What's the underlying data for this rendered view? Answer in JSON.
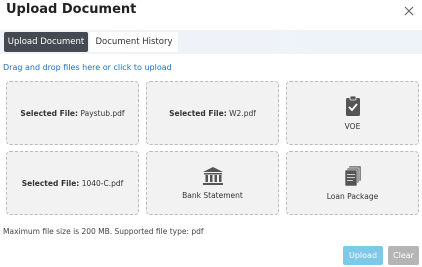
{
  "dialog": {
    "title": "Upload Document"
  },
  "tabs": [
    {
      "label": "Upload Document",
      "active": true
    },
    {
      "label": "Document History",
      "active": false
    }
  ],
  "dropzone": {
    "hint": "Drag and drop files here or click to upload"
  },
  "cards": [
    {
      "selected_label": "Selected File:",
      "file": "Paystub.pdf"
    },
    {
      "selected_label": "Selected File:",
      "file": "W2.pdf"
    },
    {
      "label": "VOE",
      "icon": "clipboard-check-icon"
    },
    {
      "selected_label": "Selected File:",
      "file": "1040-C.pdf"
    },
    {
      "label": "Bank Statement",
      "icon": "bank-icon"
    },
    {
      "label": "Loan Package",
      "icon": "document-stack-icon"
    }
  ],
  "footer": {
    "note": "Maximum file size is 200 MB. Supported file type: pdf"
  },
  "buttons": {
    "upload": "Upload",
    "clear": "Clear"
  },
  "colors": {
    "tab_active": "#454a52",
    "link": "#1e6fc4",
    "upload": "#7ec8e8",
    "clear": "#b5b5b5"
  }
}
